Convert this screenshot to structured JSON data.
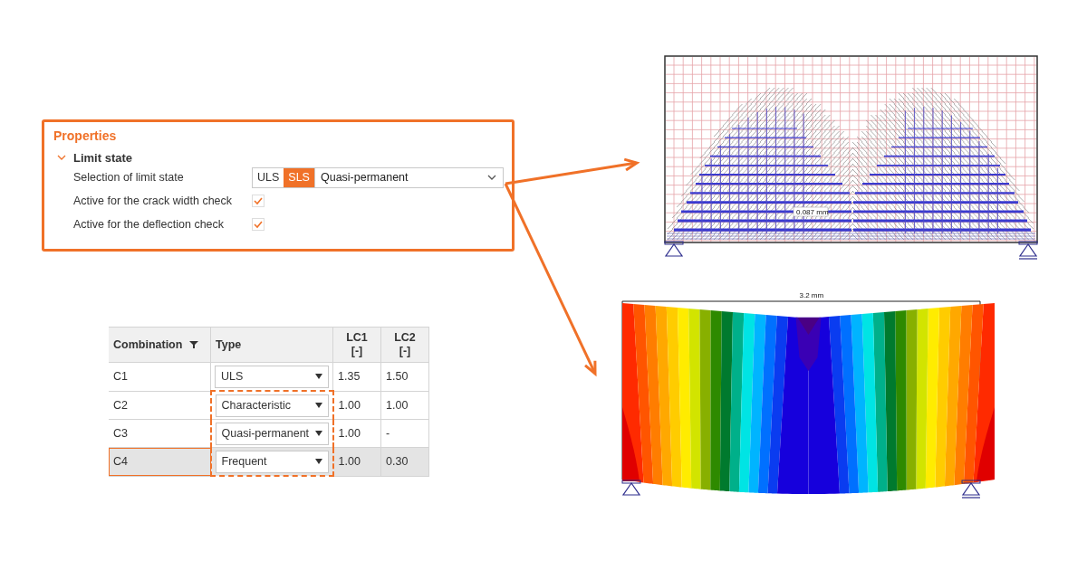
{
  "properties_panel": {
    "title": "Properties",
    "section": {
      "label": "Limit state",
      "expanded": true
    },
    "rows": [
      {
        "kind": "select",
        "label": "Selection of limit state",
        "toggle": [
          {
            "label": "ULS",
            "selected": false
          },
          {
            "label": "SLS",
            "selected": true
          }
        ],
        "value": "Quasi-permanent"
      },
      {
        "kind": "checkbox",
        "label": "Active for the crack width check",
        "checked": true
      },
      {
        "kind": "checkbox",
        "label": "Active for the deflection check",
        "checked": true
      }
    ]
  },
  "combination_table": {
    "columns": [
      {
        "label": "Combination",
        "filter": true
      },
      {
        "label": "Type",
        "filter": false
      },
      {
        "label": "LC1",
        "unit": "[-]",
        "filter": false
      },
      {
        "label": "LC2",
        "unit": "[-]",
        "filter": false
      }
    ],
    "rows": [
      {
        "name": "C1",
        "type": "ULS",
        "lc1": "1.35",
        "lc2": "1.50",
        "selected": false,
        "highlighted": false
      },
      {
        "name": "C2",
        "type": "Characteristic",
        "lc1": "1.00",
        "lc2": "1.00",
        "selected": false,
        "highlighted": true
      },
      {
        "name": "C3",
        "type": "Quasi-permanent",
        "lc1": "1.00",
        "lc2": "-",
        "selected": false,
        "highlighted": true
      },
      {
        "name": "C4",
        "type": "Frequent",
        "lc1": "1.00",
        "lc2": "0.30",
        "selected": true,
        "highlighted": true
      }
    ]
  },
  "crack_width_view": {
    "label": "0.087 mm"
  },
  "deflection_view": {
    "label": "3.2 mm"
  }
}
